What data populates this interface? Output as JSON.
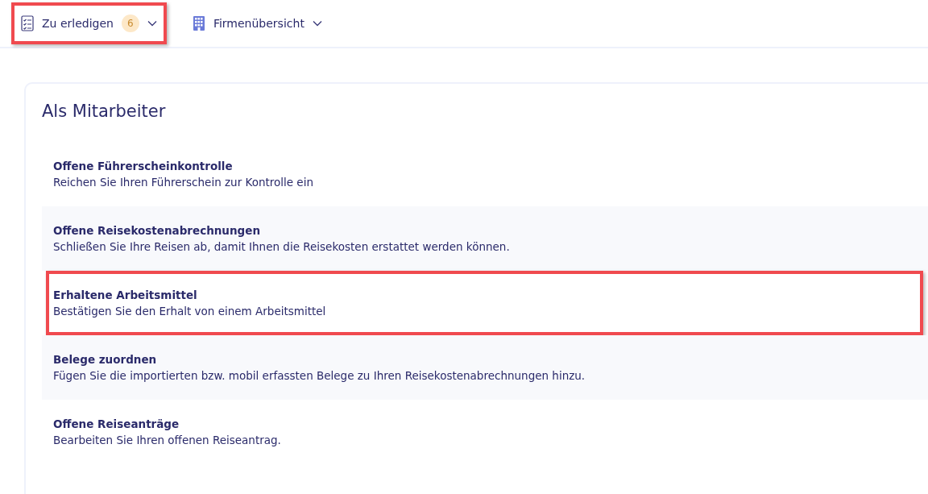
{
  "nav": [
    {
      "kind": "todo",
      "label": "Zu erledigen",
      "badge": "6",
      "highlighted": true
    },
    {
      "kind": "company",
      "label": "Firmenübersicht",
      "highlighted": false
    }
  ],
  "section": {
    "title": "Als Mitarbeiter",
    "items": [
      {
        "title": "Offene Führerscheinkontrolle",
        "description": "Reichen Sie Ihren Führerschein zur Kontrolle ein",
        "highlighted": false
      },
      {
        "title": "Offene Reisekostenabrechnungen",
        "description": "Schließen Sie Ihre Reisen ab, damit Ihnen die Reisekosten erstattet werden können.",
        "highlighted": false
      },
      {
        "title": "Erhaltene Arbeitsmittel",
        "description": "Bestätigen Sie den Erhalt von einem Arbeitsmittel",
        "highlighted": true
      },
      {
        "title": "Belege zuordnen",
        "description": "Fügen Sie die importierten bzw. mobil erfassten Belege zu Ihren Reisekostenabrechnungen hinzu.",
        "highlighted": false
      },
      {
        "title": "Offene Reiseanträge",
        "description": "Bearbeiten Sie Ihren offenen Reiseantrag.",
        "highlighted": false
      }
    ]
  }
}
